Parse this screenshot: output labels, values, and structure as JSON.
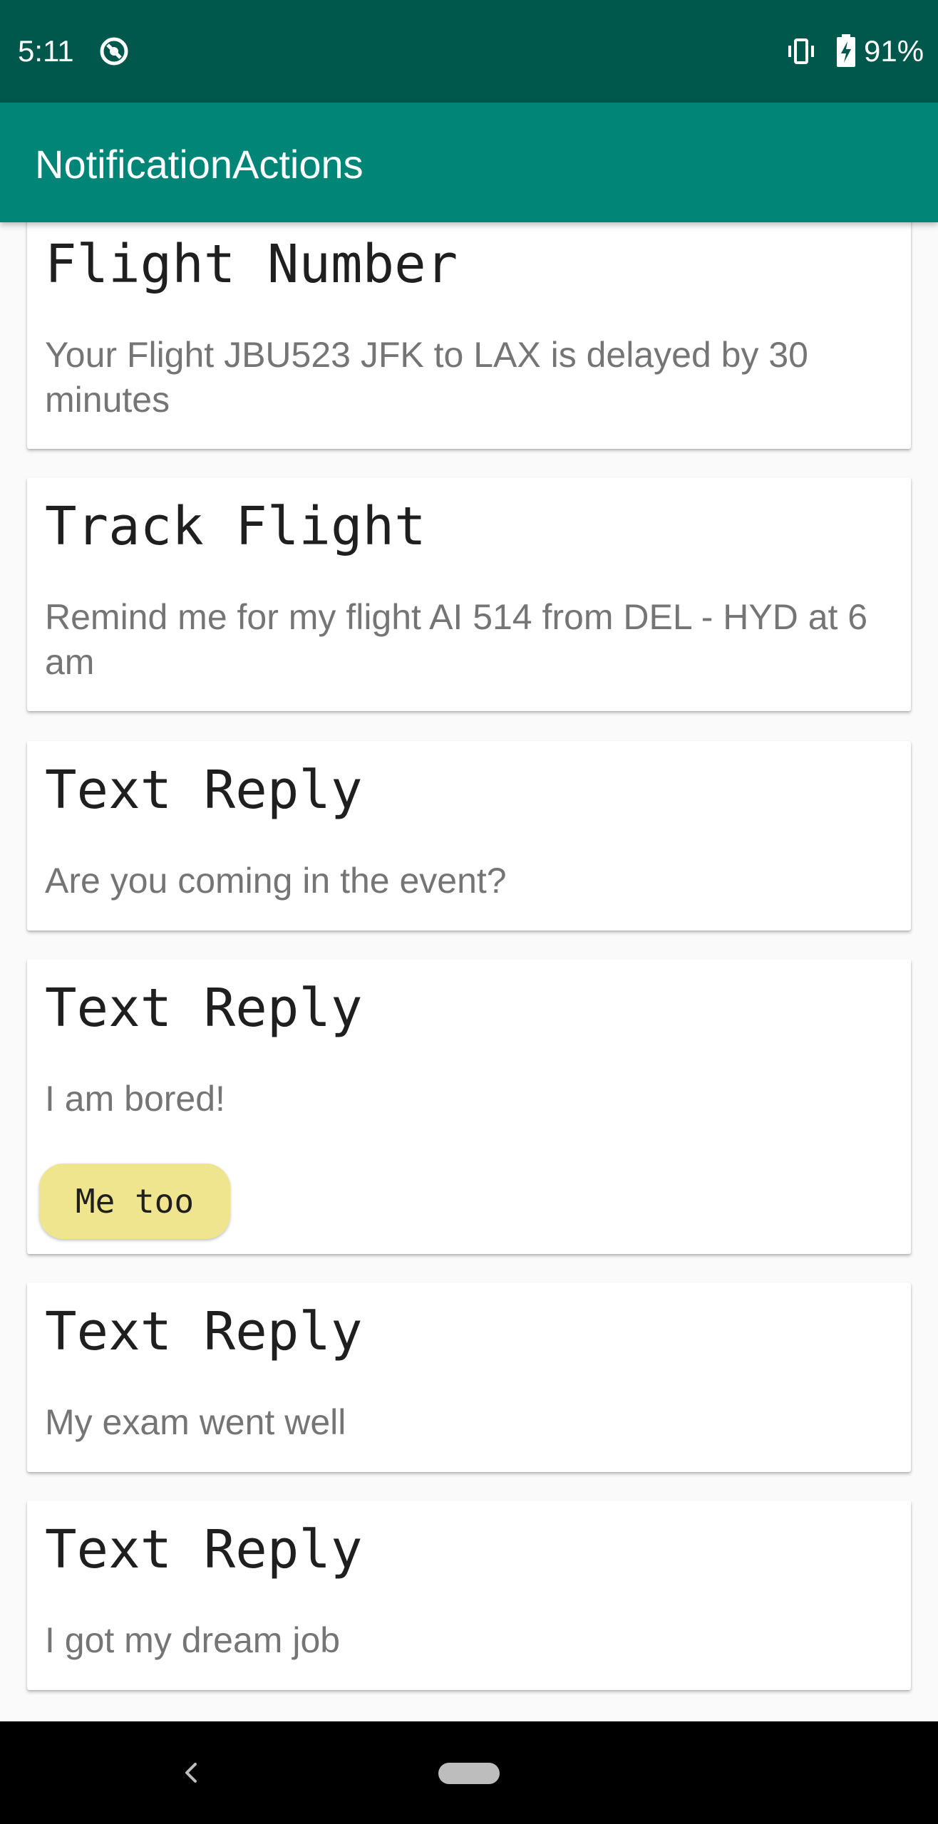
{
  "status_bar": {
    "time": "5:11",
    "battery_percent": "91%"
  },
  "app_bar": {
    "title": "NotificationActions"
  },
  "cards": [
    {
      "title": "Flight Number",
      "body": "Your Flight JBU523 JFK to LAX is delayed by 30 minutes"
    },
    {
      "title": "Track Flight",
      "body": "Remind me for my flight AI 514 from DEL - HYD at 6 am"
    },
    {
      "title": "Text Reply",
      "body": "Are you coming in the event?"
    },
    {
      "title": "Text Reply",
      "body": "I am bored!",
      "reply": "Me too"
    },
    {
      "title": "Text Reply",
      "body": "My exam went well"
    },
    {
      "title": "Text Reply",
      "body": "I got my dream job"
    }
  ],
  "colors": {
    "status_bar": "#00574b",
    "app_bar": "#008577",
    "reply_chip": "#efe58f"
  }
}
